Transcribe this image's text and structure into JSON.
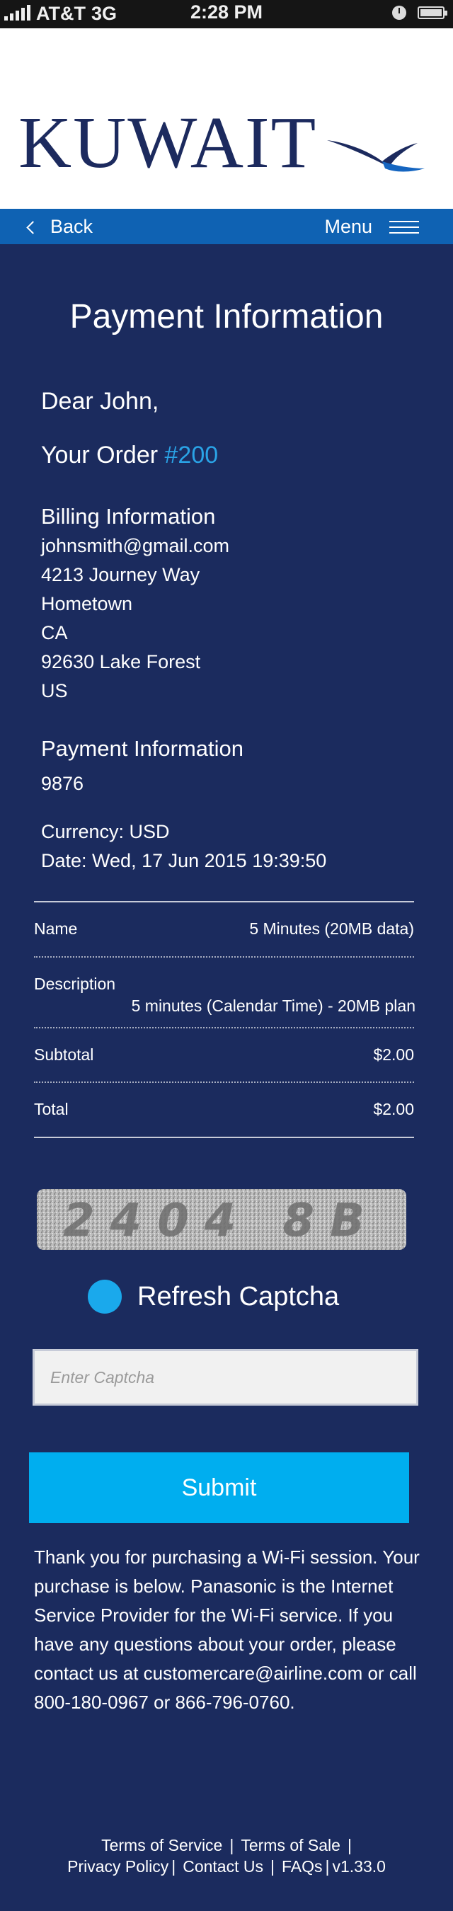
{
  "status": {
    "carrier": "AT&T",
    "network": "3G",
    "time": "2:28 PM"
  },
  "header": {
    "logo": "KUWAIT",
    "back_label": "Back",
    "menu_label": "Menu",
    "nav_color": "#0f62b3"
  },
  "page": {
    "title": "Payment Information",
    "greeting": "Dear John,",
    "order_label": "Your Order",
    "order_number": "#200"
  },
  "billing": {
    "heading": "Billing Information",
    "email": "johnsmith@gmail.com",
    "street": "4213 Journey Way",
    "town": "Hometown",
    "state": "CA",
    "zip_city": "92630 Lake Forest",
    "country": "US"
  },
  "payment": {
    "heading": "Payment Information",
    "card": "9876",
    "currency": "Currency: USD",
    "date": "Date: Wed, 17 Jun 2015 19:39:50"
  },
  "summary": {
    "name_label": "Name",
    "name_value": "5 Minutes (20MB data)",
    "description_label": "Description",
    "description_value": "5 minutes (Calendar Time) - 20MB plan",
    "subtotal_label": "Subtotal",
    "subtotal_value": "$2.00",
    "total_label": "Total",
    "total_value": "$2.00"
  },
  "captcha": {
    "image_text": "2404 8B",
    "refresh_label": "Refresh Captcha",
    "input_placeholder": "Enter Captcha",
    "input_value": ""
  },
  "submit_label": "Submit",
  "thanks_text": "Thank you for purchasing a Wi-Fi session. Your purchase is below. Panasonic is the Internet Service Provider for the Wi-Fi service. If you have any questions about your order, please contact us at customercare@airline.com or call 800-180-0967 or 866-796-0760.",
  "footer": {
    "terms_of_service": "Terms of Service",
    "terms_of_sale": "Terms of Sale",
    "privacy_policy": "Privacy Policy",
    "contact_us": "Contact Us",
    "faqs": "FAQs",
    "version": "v1.33.0"
  },
  "colors": {
    "background": "#1b2b5e",
    "accent": "#00aeef",
    "order_link": "#2aa3e6"
  }
}
